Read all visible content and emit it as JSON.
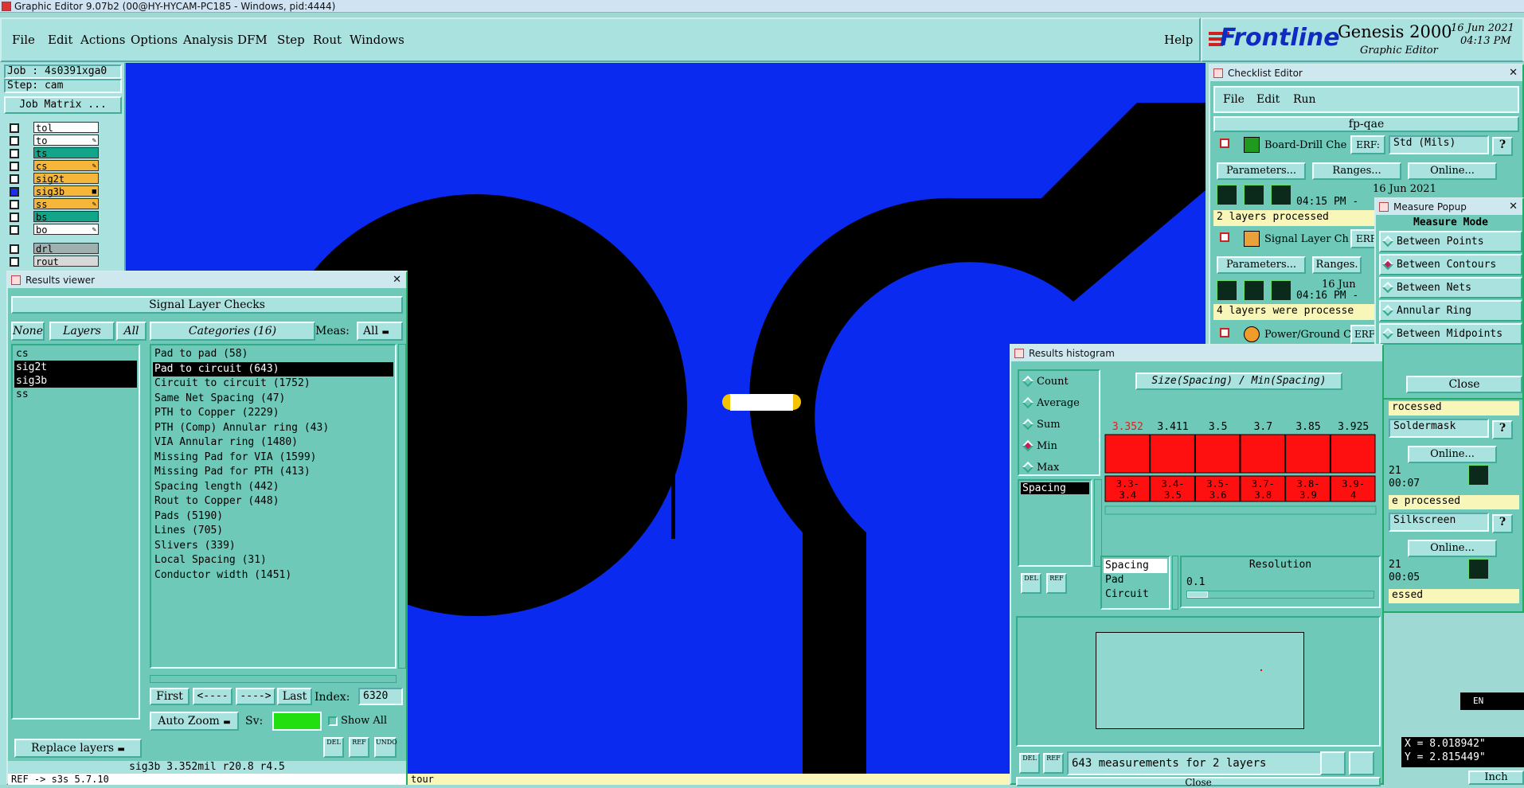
{
  "titlebar": {
    "text": "Graphic Editor 9.07b2 (00@HY-HYCAM-PC185 - Windows, pid:4444)"
  },
  "menu": {
    "file": "File",
    "edit": "Edit",
    "actions": "Actions",
    "options": "Options",
    "analysis": "Analysis",
    "dfm": "DFM",
    "step": "Step",
    "rout": "Rout",
    "windows": "Windows",
    "help": "Help"
  },
  "logo": {
    "brand": "Frontline",
    "product": "Genesis 2000",
    "subtitle": "Graphic Editor",
    "date": "16 Jun 2021",
    "time": "04:13 PM"
  },
  "job": {
    "job_label": "Job : 4s0391xga0",
    "step_label": "Step: cam",
    "matrix_button": "Job Matrix ..."
  },
  "layers": [
    {
      "name": "tol",
      "color": "#ffffff",
      "mark": ""
    },
    {
      "name": "to",
      "color": "#ffffff",
      "mark": "✎"
    },
    {
      "name": "ts",
      "color": "#13a58a",
      "mark": ""
    },
    {
      "name": "cs",
      "color": "#f5b63a",
      "mark": "✎"
    },
    {
      "name": "sig2t",
      "color": "#f5b63a",
      "mark": ""
    },
    {
      "name": "sig3b",
      "color": "#f5b63a",
      "mark": "■"
    },
    {
      "name": "ss",
      "color": "#f5b63a",
      "mark": "✎"
    },
    {
      "name": "bs",
      "color": "#13a58a",
      "mark": ""
    },
    {
      "name": "bo",
      "color": "#ffffff",
      "mark": "✎"
    },
    {
      "name": "drl",
      "color": "#9fb0b0",
      "mark": ""
    },
    {
      "name": "rout",
      "color": "#d8d8d8",
      "mark": ""
    }
  ],
  "results_viewer": {
    "title": "Results viewer",
    "heading": "Signal Layer Checks",
    "none_btn": "None",
    "layers_btn": "Layers",
    "all_btn": "All",
    "categories_btn": "Categories (16)",
    "meas_label": "Meas:",
    "meas_value": "All",
    "layer_list": [
      "cs",
      "sig2t",
      "sig3b",
      "ss"
    ],
    "categories": [
      "Pad to pad (58)",
      "Pad to circuit (643)",
      "Circuit to circuit (1752)",
      "Same Net Spacing (47)",
      "PTH to Copper (2229)",
      "PTH (Comp) Annular ring (43)",
      "VIA Annular ring (1480)",
      "Missing Pad for VIA (1599)",
      "Missing Pad for PTH (413)",
      "Spacing length (442)",
      "Rout to Copper (448)",
      "Pads (5190)",
      "Lines (705)",
      "Slivers (339)",
      "Local Spacing (31)",
      "Conductor width (1451)"
    ],
    "first_btn": "First",
    "prev_btn": "<----",
    "next_btn": "---->",
    "last_btn": "Last",
    "index_label": "Index:",
    "index_value": "6320",
    "autozoom_btn": "Auto Zoom",
    "sv_label": "Sv:",
    "show_all": "Show All",
    "replace_btn": "Replace layers",
    "del": "DEL",
    "ref": "REF",
    "undo": "UNDO",
    "status": "sig3b 3.352mil  r20.8  r4.5",
    "status2": "REF -> s3s  5.7.10"
  },
  "checklist": {
    "title": "Checklist Editor",
    "file": "File",
    "edit": "Edit",
    "run": "Run",
    "name": "fp-qae",
    "items": [
      {
        "name": "Board-Drill Che",
        "erf": "ERF:",
        "erf_value": "Std (Mils)",
        "params": "Parameters...",
        "ranges": "Ranges...",
        "online": "Online...",
        "date": "16 Jun 2021",
        "time": "04:15 PM -",
        "status": "2 layers processed"
      },
      {
        "name": "Signal Layer Ch",
        "erf": "ERF",
        "params": "Parameters...",
        "ranges": "Ranges.",
        "date": "16 Jun",
        "time": "04:16 PM -",
        "status": "4 layers were processe"
      },
      {
        "name": "Power/Ground C",
        "erf": "ERF"
      }
    ],
    "frag1": "rocessed",
    "frag2": "Soldermask",
    "frag3": "Online...",
    "frag4": "21",
    "frag5": "00:07",
    "frag6": "e processed",
    "frag7": "Silkscreen",
    "frag8": "Online...",
    "frag9": "21",
    "frag10": "00:05",
    "frag11": "essed",
    "help": "?"
  },
  "measure": {
    "title": "Measure Popup",
    "mode": "Measure Mode",
    "options": [
      "Between Points",
      "Between Contours",
      "Between Nets",
      "Annular Ring",
      "Between Midpoints"
    ],
    "selected": 1,
    "close": "Close"
  },
  "histogram": {
    "title": "Results histogram",
    "modes": [
      "Count",
      "Average",
      "Sum",
      "Min",
      "Max"
    ],
    "selected": 3,
    "chart_title": "Size(Spacing) / Min(Spacing)",
    "spacing_list": [
      "Spacing"
    ],
    "types": [
      "Spacing",
      "Pad",
      "Circuit"
    ],
    "resolution_label": "Resolution",
    "resolution_value": "0.1",
    "summary": "643 measurements for 2 layers",
    "close": "Close",
    "del": "DEL",
    "ref": "REF"
  },
  "chart_data": {
    "type": "bar",
    "title": "Size(Spacing) / Min(Spacing)",
    "categories": [
      "3.3-3.4",
      "3.4-3.5",
      "3.5-3.6",
      "3.7-3.8",
      "3.8-3.9",
      "3.9-4"
    ],
    "values": [
      3.352,
      3.411,
      3.5,
      3.7,
      3.85,
      3.925
    ],
    "value_labels": [
      "3.352",
      "3.411",
      "3.5",
      "3.7",
      "3.85",
      "3.925"
    ],
    "colors": {
      "bar": "#ff1010",
      "first_label": "#e0201a"
    }
  },
  "coords": {
    "x": "X = 8.018942\"",
    "y": "Y = 2.815449\"",
    "units": "Inch"
  },
  "canvas_footer": "tour",
  "lang": "EN"
}
